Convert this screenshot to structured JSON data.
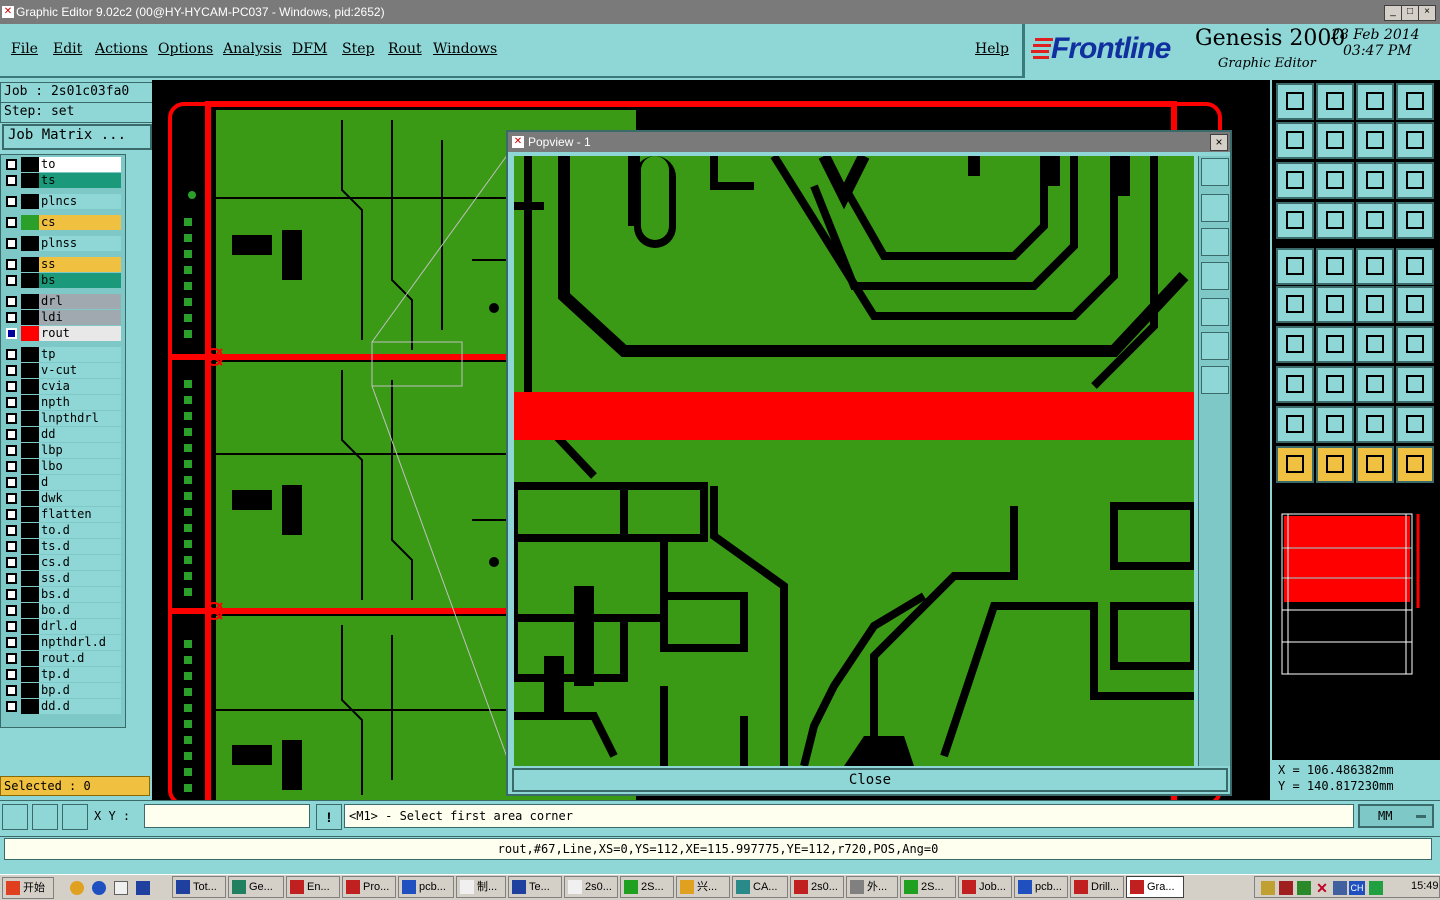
{
  "window": {
    "title": "Graphic Editor 9.02c2 (00@HY-HYCAM-PC037 - Windows, pid:2652)",
    "controls": [
      "_",
      "□",
      "×"
    ]
  },
  "menu": {
    "items": [
      "File",
      "Edit",
      "Actions",
      "Options",
      "Analysis",
      "DFM",
      "Step",
      "Rout",
      "Windows"
    ],
    "help": "Help"
  },
  "brand": {
    "logo": "Frontline",
    "product": "Genesis 2000",
    "subtitle": "Graphic Editor",
    "date": "28 Feb 2014",
    "time": "03:47 PM"
  },
  "job": {
    "job_label": "Job : 2s01c03fa0",
    "step_label": "Step: set",
    "matrix_button": "Job Matrix ..."
  },
  "layers": [
    {
      "name": "to",
      "color": "#ffffff",
      "swatch": "#000000"
    },
    {
      "name": "ts",
      "color": "#1a9a7a",
      "swatch": "#000000"
    },
    {
      "name": "plncs",
      "color": "#8fd6d6",
      "swatch": "#000000"
    },
    {
      "name": "cs",
      "color": "#f0c040",
      "swatch": "#2aa02a"
    },
    {
      "name": "plnss",
      "color": "#8fd6d6",
      "swatch": "#000000"
    },
    {
      "name": "ss",
      "color": "#f0c040",
      "swatch": "#000000"
    },
    {
      "name": "bs",
      "color": "#1a9a7a",
      "swatch": "#000000"
    },
    {
      "name": "drl",
      "color": "#a0a8b0",
      "swatch": "#000000"
    },
    {
      "name": "ldi",
      "color": "#a0a8b0",
      "swatch": "#000000"
    },
    {
      "name": "rout",
      "color": "#e8e8e8",
      "swatch": "#ff0000"
    },
    {
      "name": "tp",
      "color": "#8fd6d6",
      "swatch": "#000000"
    },
    {
      "name": "v-cut",
      "color": "#8fd6d6",
      "swatch": "#000000"
    },
    {
      "name": "cvia",
      "color": "#8fd6d6",
      "swatch": "#000000"
    },
    {
      "name": "npth",
      "color": "#8fd6d6",
      "swatch": "#000000"
    },
    {
      "name": "lnpthdrl",
      "color": "#8fd6d6",
      "swatch": "#000000"
    },
    {
      "name": "dd",
      "color": "#8fd6d6",
      "swatch": "#000000"
    },
    {
      "name": "lbp",
      "color": "#8fd6d6",
      "swatch": "#000000"
    },
    {
      "name": "lbo",
      "color": "#8fd6d6",
      "swatch": "#000000"
    },
    {
      "name": "d",
      "color": "#8fd6d6",
      "swatch": "#000000"
    },
    {
      "name": "dwk",
      "color": "#8fd6d6",
      "swatch": "#000000"
    },
    {
      "name": "flatten",
      "color": "#8fd6d6",
      "swatch": "#000000"
    },
    {
      "name": "to.d",
      "color": "#8fd6d6",
      "swatch": "#000000"
    },
    {
      "name": "ts.d",
      "color": "#8fd6d6",
      "swatch": "#000000"
    },
    {
      "name": "cs.d",
      "color": "#8fd6d6",
      "swatch": "#000000"
    },
    {
      "name": "ss.d",
      "color": "#8fd6d6",
      "swatch": "#000000"
    },
    {
      "name": "bs.d",
      "color": "#8fd6d6",
      "swatch": "#000000"
    },
    {
      "name": "bo.d",
      "color": "#8fd6d6",
      "swatch": "#000000"
    },
    {
      "name": "drl.d",
      "color": "#8fd6d6",
      "swatch": "#000000"
    },
    {
      "name": "npthdrl.d",
      "color": "#8fd6d6",
      "swatch": "#000000"
    },
    {
      "name": "rout.d",
      "color": "#8fd6d6",
      "swatch": "#000000"
    },
    {
      "name": "tp.d",
      "color": "#8fd6d6",
      "swatch": "#000000"
    },
    {
      "name": "bp.d",
      "color": "#8fd6d6",
      "swatch": "#000000"
    },
    {
      "name": "dd.d",
      "color": "#8fd6d6",
      "swatch": "#000000"
    }
  ],
  "selected": "Selected : 0",
  "popview": {
    "title": "Popview - 1",
    "close_button": "Close",
    "close_x": "×"
  },
  "coords": {
    "x": "X = 106.486382mm",
    "y": "Y = 140.817230mm"
  },
  "command": {
    "xy_label": "X Y :",
    "xy_value": "",
    "alert": "!",
    "prompt": "<M1> - Select first area corner",
    "units": "MM"
  },
  "status": "rout,#67,Line,XS=0,YS=112,XE=115.997775,YE=112,r720,POS,Ang=0",
  "taskbar": {
    "start": "开始",
    "buttons": [
      "Tot...",
      "Ge...",
      "En...",
      "Pro...",
      "pcb...",
      "制...",
      "Te...",
      "2s0...",
      "2S...",
      "兴...",
      "CA...",
      "2s0...",
      "外...",
      "2S...",
      "Job...",
      "pcb...",
      "Drill...",
      "Gra..."
    ],
    "tray_lang": "CH",
    "clock": "15:49"
  },
  "colors": {
    "panel": "#8fd6d6",
    "pcb_green": "#3a9a16",
    "rout_red": "#ff0000",
    "highlight": "#f0c040"
  }
}
